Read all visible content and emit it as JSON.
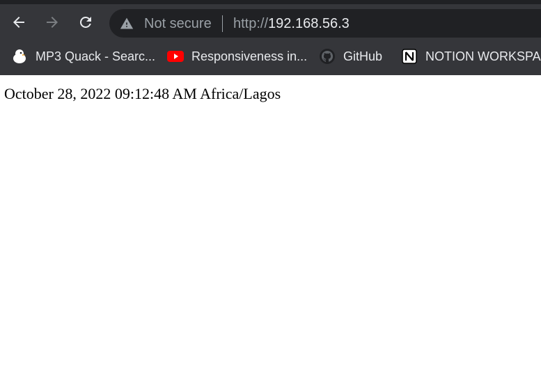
{
  "browser": {
    "security_label": "Not secure",
    "url_scheme": "http://",
    "url_host": "192.168.56.3",
    "bookmarks": [
      {
        "label": "MP3 Quack - Searc...",
        "icon": "duck-icon"
      },
      {
        "label": "Responsiveness in...",
        "icon": "youtube-icon"
      },
      {
        "label": "GitHub",
        "icon": "github-icon"
      },
      {
        "label": "NOTION WORKSPA...",
        "icon": "notion-icon"
      }
    ],
    "colors": {
      "chrome_bg": "#35363a",
      "omnibox_bg": "#202124",
      "text_dim": "#9aa0a6",
      "text_bright": "#e8eaed",
      "youtube_red": "#ff0000"
    }
  },
  "page": {
    "datetime_text": "October 28, 2022 09:12:48 AM Africa/Lagos"
  }
}
